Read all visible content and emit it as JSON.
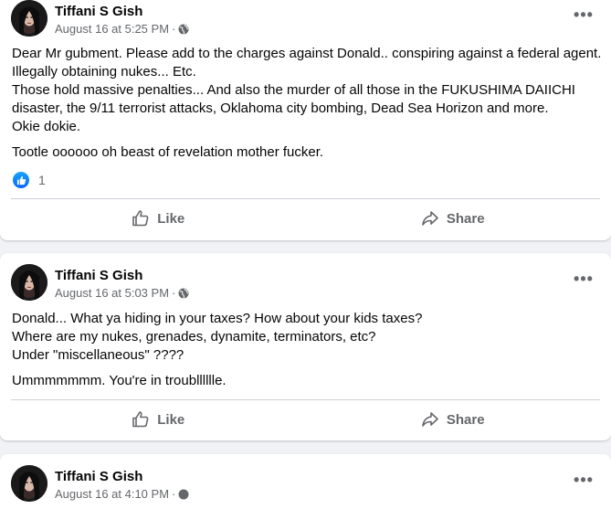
{
  "colors": {
    "background": "#f0f2f5",
    "card": "#ffffff",
    "secondary_text": "#65676b",
    "like_blue": "#0866ff"
  },
  "posts": [
    {
      "author": "Tiffani S Gish",
      "timestamp": "August 16 at 5:25 PM",
      "separator": "·",
      "privacy_icon": "globe-icon",
      "paragraphs": [
        "Dear Mr gubment. Please add to the charges against Donald.. conspiring against a federal agent. Illegally obtaining nukes... Etc.\nThose hold massive penalties... And also the murder of all those in the FUKUSHIMA DAIICHI disaster, the 9/11 terrorist attacks, Oklahoma city bombing, Dead Sea Horizon and more.\nOkie dokie.",
        "Tootle oooooo oh beast of revelation mother fucker."
      ],
      "reaction_count": "1",
      "like_label": "Like",
      "share_label": "Share"
    },
    {
      "author": "Tiffani S Gish",
      "timestamp": "August 16 at 5:03 PM",
      "separator": "·",
      "privacy_icon": "globe-icon",
      "paragraphs": [
        "Donald... What ya hiding in your taxes? How about your kids taxes?\nWhere are my nukes, grenades, dynamite, terminators, etc?\nUnder \"miscellaneous\" ????",
        "Ummmmmmm. You're in troublllllle."
      ],
      "like_label": "Like",
      "share_label": "Share"
    },
    {
      "author": "Tiffani S Gish",
      "timestamp": "August 16 at 4:10 PM",
      "separator": "·",
      "privacy_icon": "globe-icon"
    }
  ]
}
